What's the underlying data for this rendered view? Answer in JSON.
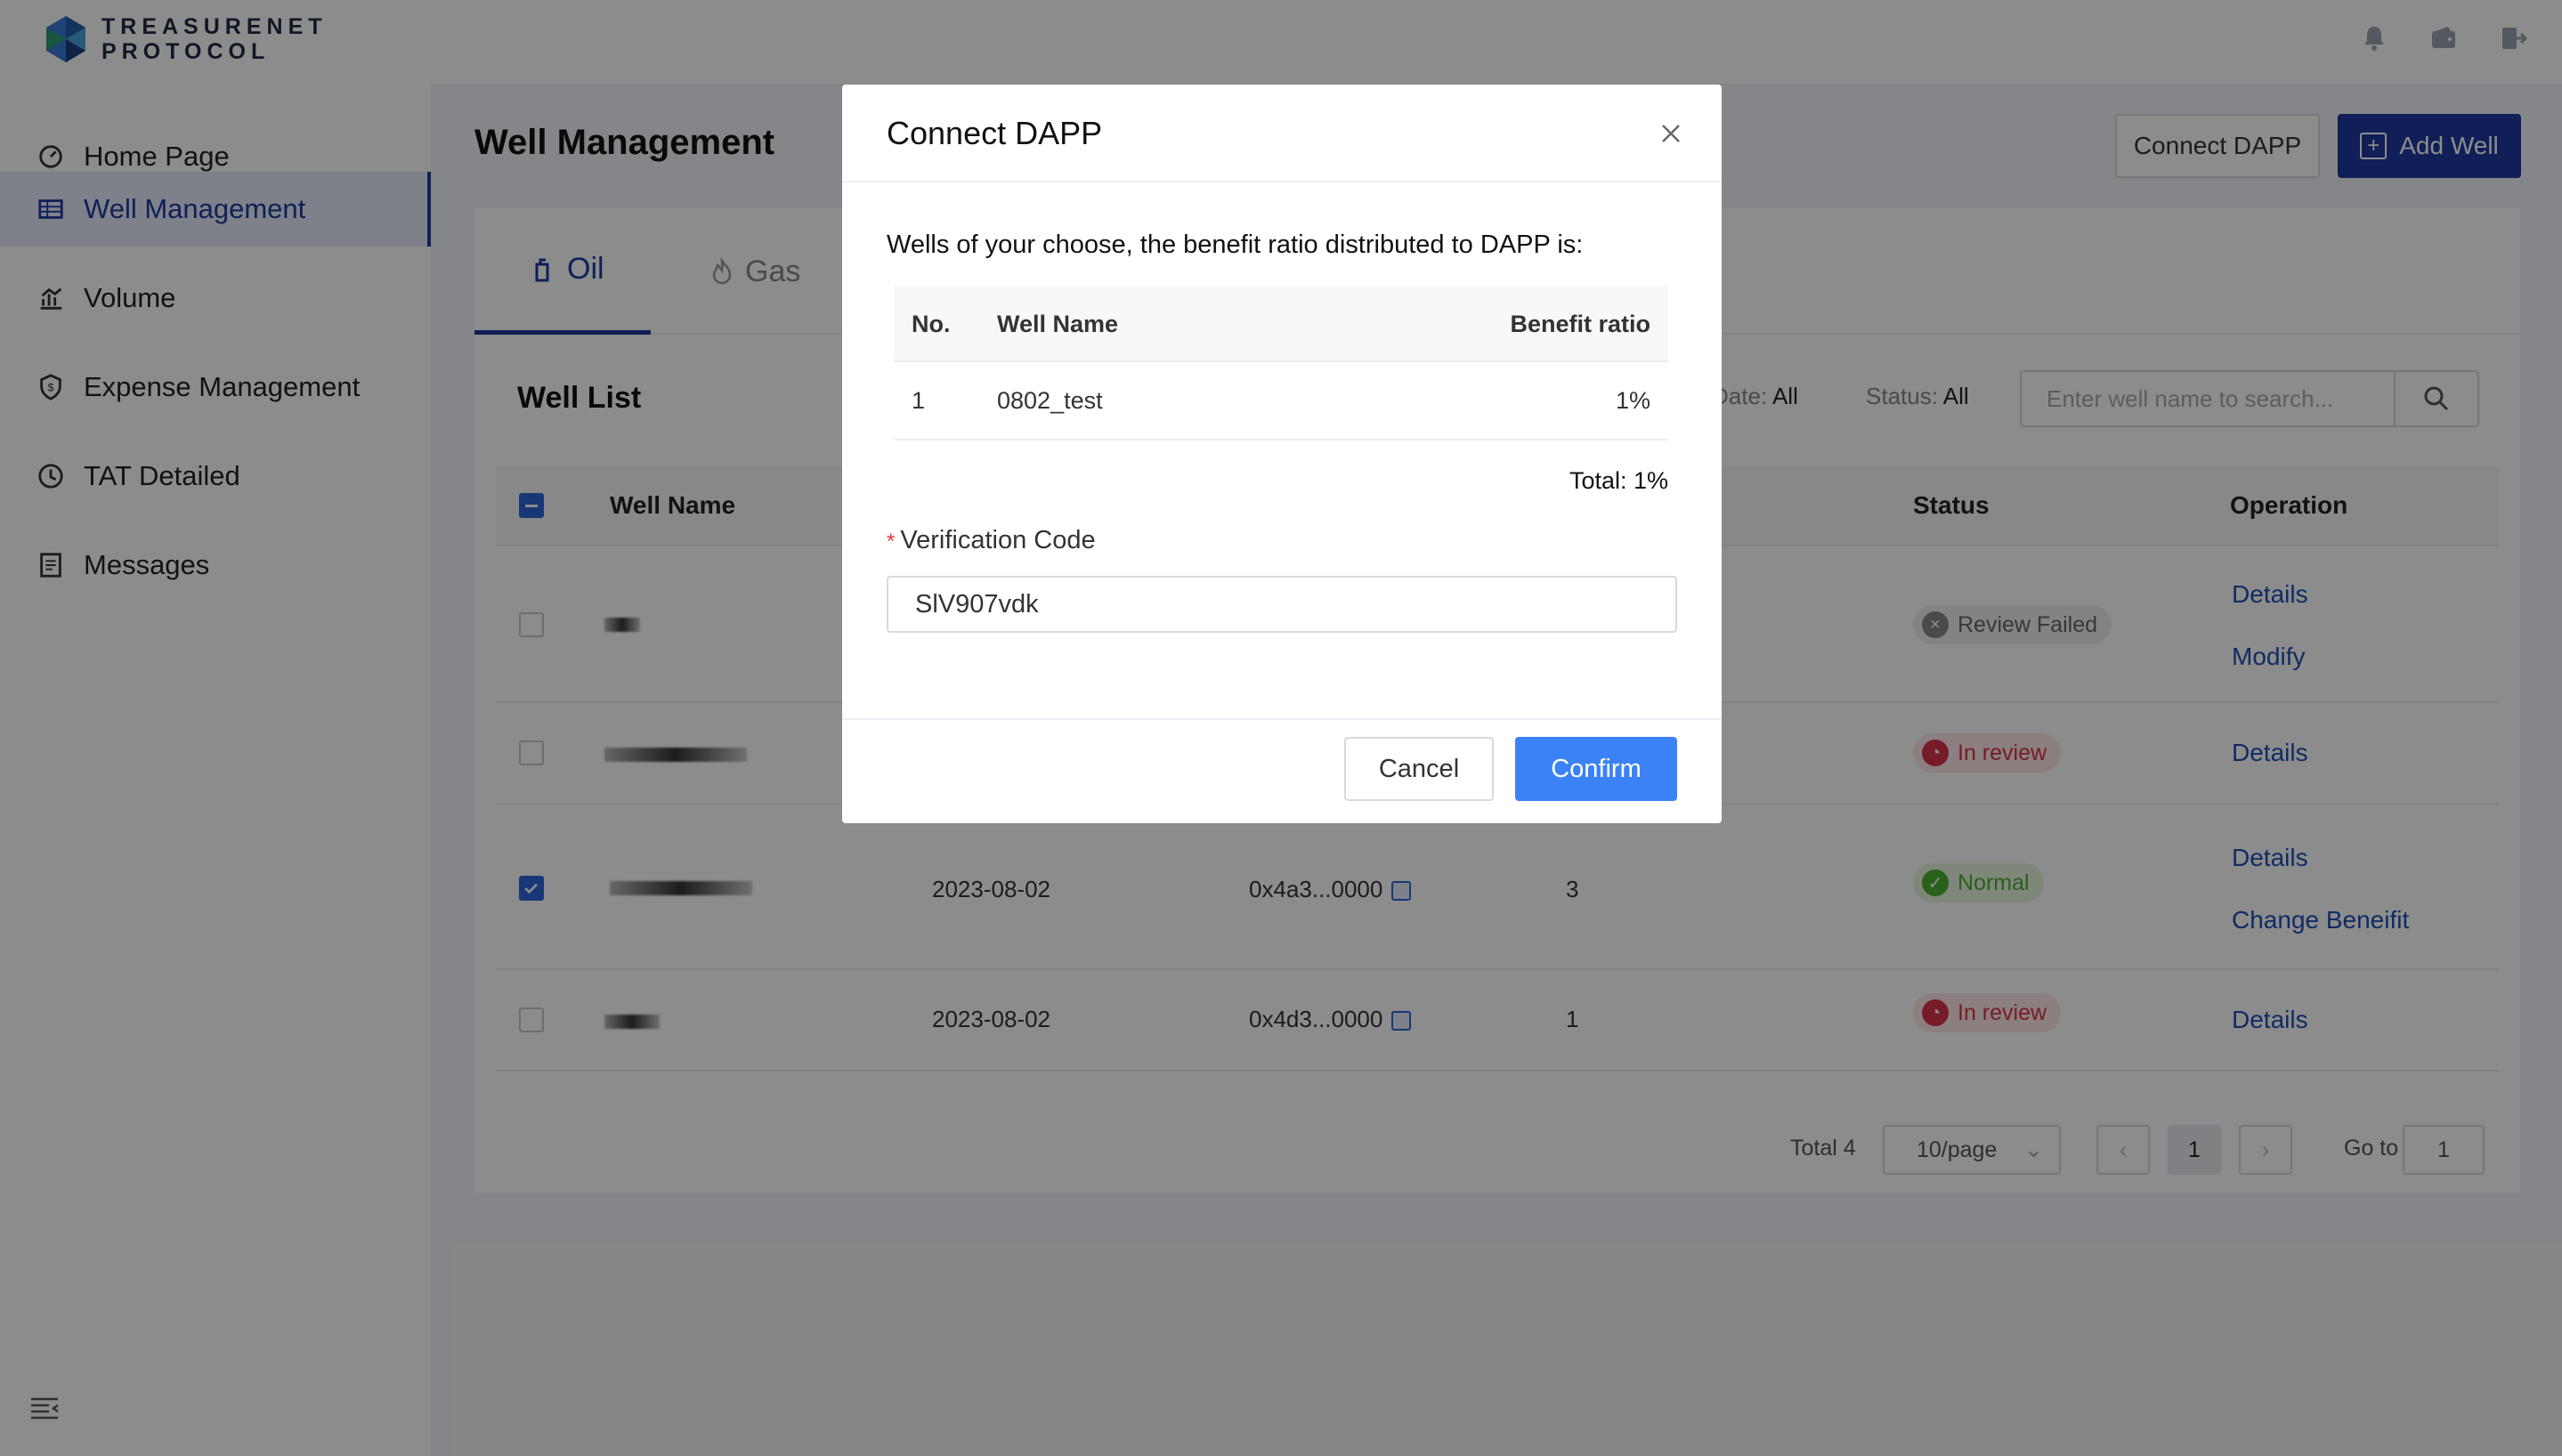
{
  "app": {
    "logo_line1": "TREASURENET",
    "logo_line2": "PROTOCOL"
  },
  "header": {
    "icons": [
      "bell-icon",
      "wallet-icon",
      "logout-icon"
    ]
  },
  "sidebar": {
    "items": [
      {
        "label": "Home Page",
        "icon": "dashboard-icon"
      },
      {
        "label": "Well Management",
        "icon": "table-icon",
        "active": true
      },
      {
        "label": "Volume",
        "icon": "chart-icon"
      },
      {
        "label": "Expense Management",
        "icon": "shield-icon"
      },
      {
        "label": "TAT Detailed",
        "icon": "clock-icon"
      },
      {
        "label": "Messages",
        "icon": "document-icon"
      }
    ]
  },
  "page": {
    "title": "Well Management",
    "connect_dapp_label": "Connect DAPP",
    "add_well_label": "Add Well",
    "tabs": [
      {
        "label": "Oil"
      },
      {
        "label": "Gas"
      }
    ],
    "list_title": "Well List",
    "filter_date_label": "Date:",
    "filter_date_value": "All",
    "filter_status_label": "Status:",
    "filter_status_value": "All",
    "search_placeholder": "Enter well name to search...",
    "columns": {
      "well_name": "Well Name",
      "status": "Status",
      "operation": "Operation"
    },
    "rows": [
      {
        "date": "",
        "address": "",
        "count": "",
        "status": "Review Failed",
        "status_kind": "fail",
        "ops": [
          "Details",
          "Modify"
        ],
        "checked": false
      },
      {
        "date": "",
        "address": "",
        "count": "",
        "status": "In review",
        "status_kind": "review",
        "ops": [
          "Details"
        ],
        "checked": false
      },
      {
        "date": "2023-08-02",
        "address": "0x4a3...0000",
        "count": "3",
        "status": "Normal",
        "status_kind": "normal",
        "ops": [
          "Details",
          "Change Beneifit"
        ],
        "checked": true
      },
      {
        "date": "2023-08-02",
        "address": "0x4d3...0000",
        "count": "1",
        "status": "In review",
        "status_kind": "review",
        "ops": [
          "Details"
        ],
        "checked": false
      }
    ],
    "pagination": {
      "total": "Total 4",
      "page_size": "10/page",
      "current": "1",
      "goto_label": "Go to",
      "goto_value": "1"
    }
  },
  "modal": {
    "title": "Connect DAPP",
    "description": "Wells of your choose, the benefit ratio distributed to DAPP is:",
    "table_headers": {
      "no": "No.",
      "well_name": "Well Name",
      "ratio": "Benefit ratio"
    },
    "table_rows": [
      {
        "no": "1",
        "well_name": "0802_test",
        "ratio": "1%"
      }
    ],
    "total": "Total: 1%",
    "verification_label": "Verification Code",
    "verification_value": "SlV907vdk",
    "cancel_label": "Cancel",
    "confirm_label": "Confirm"
  },
  "colors": {
    "brand": "#1e3a9e",
    "primary": "#3b82f6",
    "danger": "#d8334a",
    "success": "#4caf30"
  }
}
